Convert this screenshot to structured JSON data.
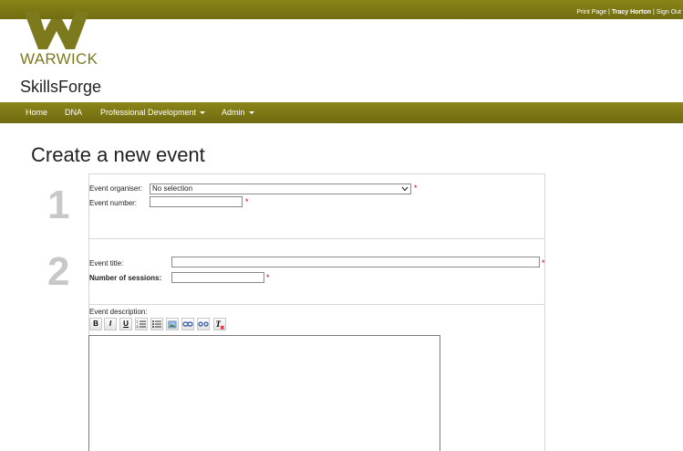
{
  "topbar": {
    "print_label": "Print Page",
    "separator": "|",
    "user_name": "Tracy Horton",
    "signout_label": "Sign Out"
  },
  "brand": {
    "wordmark": "WARWICK",
    "app_name": "SkillsForge",
    "color": "#7d7a1d"
  },
  "nav": {
    "items": [
      {
        "label": "Home"
      },
      {
        "label": "DNA"
      },
      {
        "label": "Professional Development",
        "dropdown": true
      },
      {
        "label": "Admin",
        "dropdown": true
      }
    ],
    "color": "#7d7815"
  },
  "page": {
    "title": "Create a new event"
  },
  "form": {
    "step1": {
      "number": "1",
      "organiser_label": "Event organiser:",
      "organiser_value": "No selection",
      "number_label": "Event number:",
      "number_value": ""
    },
    "step2": {
      "number": "2",
      "title_label": "Event title:",
      "title_value": "",
      "sessions_label": "Number of sessions:",
      "sessions_value": ""
    },
    "description_label": "Event description:",
    "required_marker": "*",
    "toolbar": {
      "bold": "B",
      "italic": "I",
      "underline": "U",
      "icons": [
        "bold-icon",
        "italic-icon",
        "underline-icon",
        "numbered-list-icon",
        "bullet-list-icon",
        "image-icon",
        "link-icon",
        "unlink-icon",
        "remove-format-icon"
      ]
    }
  }
}
